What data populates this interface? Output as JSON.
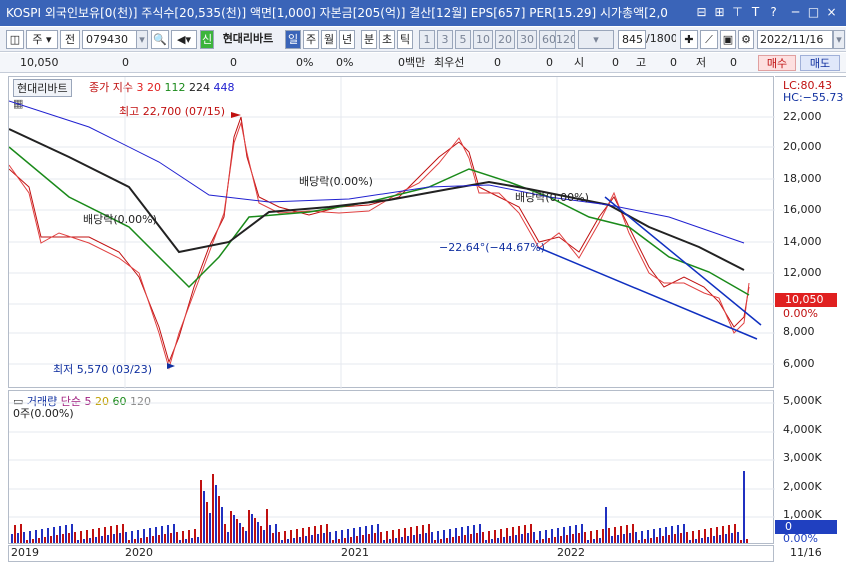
{
  "title": "KOSPI 외국인보유[0(천)] 주식수[20,535(천)] 액면[1,000] 자본금[205(억)] 결산[12월] EPS[657] PER[15.29] 시가총액[2,0",
  "window_buttons": [
    "⊟",
    "⊞",
    "⊤",
    "T",
    "?",
    "─",
    "□",
    "×"
  ],
  "toolbar": {
    "mode": "주",
    "period_label": "전",
    "code": "079430",
    "search_icon": "🔍",
    "sound_icon": "◀",
    "sin": "신",
    "name": "현대리바트",
    "intervals": [
      "일",
      "주",
      "월",
      "년",
      "분",
      "초",
      "틱"
    ],
    "active_interval": "일",
    "numbers": [
      "1",
      "3",
      "5",
      "10",
      "20",
      "30",
      "60",
      "120"
    ],
    "count": "845",
    "total": "/1800",
    "date": "2022/11/16"
  },
  "info": {
    "price": "10,050",
    "v1": "0",
    "v2": "0",
    "v3": "0%",
    "v4": "0%",
    "vol": "0백만",
    "label_first": "최우선",
    "f1": "0",
    "f2": "0",
    "si": "시",
    "si_v": "0",
    "go": "고",
    "go_v": "0",
    "jeo": "저",
    "jeo_v": "0",
    "buy": "매수",
    "sell": "매도"
  },
  "legend": {
    "name": "현대리바트",
    "price_label": "종가",
    "index_label": "지수",
    "ma": [
      "3",
      "20",
      "112",
      "224",
      "448"
    ],
    "ma_colors": [
      "#e02020",
      "#e02020",
      "#1a8a1a",
      "#222222",
      "#2020d0"
    ]
  },
  "annotations": {
    "high": "최고 22,700 (07/15)",
    "low": "최저 5,570 (03/23)",
    "div1": "배당락(0.00%)",
    "div2": "배당락(0.00%)",
    "div3": "배당락(0.00%)",
    "trend": "−22.64°(−44.67%)",
    "lc": "LC:80.43",
    "hc": "HC:−55.73"
  },
  "price_axis": [
    "22,000",
    "20,000",
    "18,000",
    "16,000",
    "14,000",
    "12,000",
    "10,000",
    "8,000",
    "6,000"
  ],
  "price_tag": "10,050",
  "price_tag2": "0.00%",
  "vol_legend": {
    "title": "거래량",
    "type": "단순",
    "ma": [
      "5",
      "20",
      "60",
      "120"
    ],
    "sub": "0주(0.00%)"
  },
  "vol_axis": [
    "5,000K",
    "4,000K",
    "3,000K",
    "2,000K",
    "1,000K"
  ],
  "vol_tag": "0",
  "vol_tag2": "0.00%",
  "x_labels": [
    "2019",
    "2020",
    "2021",
    "2022"
  ],
  "x_right": "11/16"
}
